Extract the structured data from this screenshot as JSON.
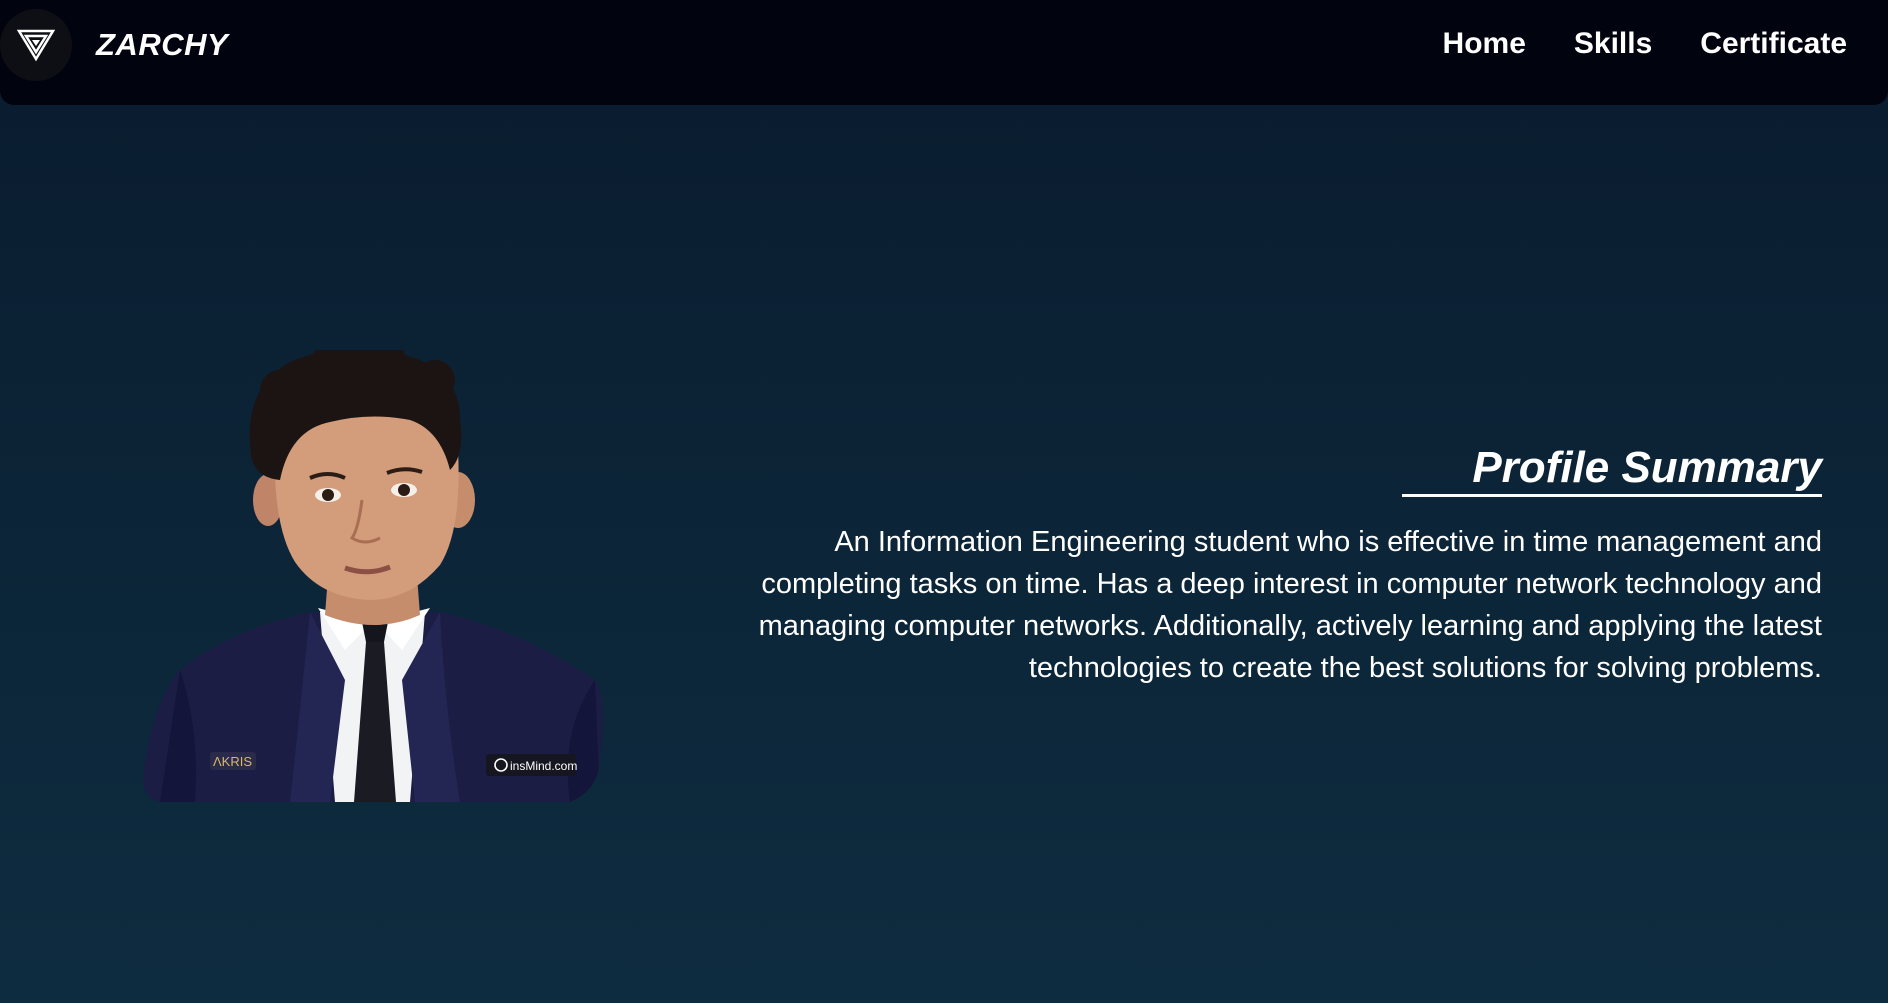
{
  "brand": {
    "name": "ZARCHY",
    "logo_icon": "triangle-logo-icon"
  },
  "nav": {
    "items": [
      {
        "label": "Home"
      },
      {
        "label": "Skills"
      },
      {
        "label": "Certificate"
      }
    ]
  },
  "profile": {
    "photo_badge_left": "ΛKRIS",
    "photo_watermark": "insMind.com"
  },
  "summary": {
    "title": "Profile Summary",
    "text": "An Information Engineering student who is effective in time management and completing tasks on time. Has a deep interest in computer network technology and managing computer networks. Additionally, actively learning and applying the latest technologies to create the best solutions for solving problems."
  },
  "colors": {
    "navbar_bg": "#01040f",
    "page_bg_top": "#0a1b2e",
    "page_bg_bottom": "#0e2c40",
    "text": "#ffffff"
  }
}
